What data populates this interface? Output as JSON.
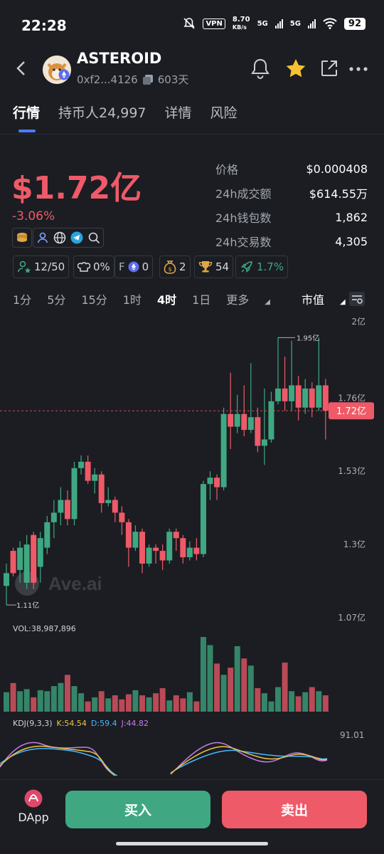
{
  "status_bar": {
    "time": "22:28",
    "vpn": "VPN",
    "speed": "8.70",
    "speed_unit": "KB/s",
    "net1": "5G",
    "net2": "5G",
    "battery": "92"
  },
  "header": {
    "title": "ASTEROID",
    "address": "0xf2...4126",
    "age": "603天"
  },
  "tabs": [
    "行情",
    "持币人24,997",
    "详情",
    "风险"
  ],
  "market": {
    "cap": "$1.72亿",
    "change": "-3.06%"
  },
  "stats": [
    {
      "label": "价格",
      "value": "$0.000408"
    },
    {
      "label": "24h成交额",
      "value": "$614.55万"
    },
    {
      "label": "24h钱包数",
      "value": "1,862"
    },
    {
      "label": "24h交易数",
      "value": "4,305"
    }
  ],
  "chips": {
    "holders": "12/50",
    "cook": "0%",
    "f": "F",
    "f_val": "0",
    "money": "2",
    "trophy": "54",
    "rocket": "1.7%"
  },
  "timeframes": {
    "items": [
      "1分",
      "5分",
      "15分",
      "1时",
      "4时",
      "1日"
    ],
    "active": "4时",
    "more": "更多",
    "metric": "市值"
  },
  "colors": {
    "up": "#3fa882",
    "down": "#ef5a68",
    "accent": "#4a7dff",
    "buy": "#3fa882",
    "sell": "#ef5a68"
  },
  "chart_data": {
    "type": "candlestick",
    "y_ticks": [
      "2亿",
      "1.76亿",
      "1.53亿",
      "1.3亿",
      "1.07亿"
    ],
    "current_label": "1.72亿",
    "high_label": "1.95亿",
    "low_label": "1.11亿",
    "watermark": "Ave.ai",
    "candles": [
      [
        1.17,
        1.21,
        1.24,
        1.11
      ],
      [
        1.28,
        1.21,
        1.29,
        1.2
      ],
      [
        1.22,
        1.29,
        1.31,
        1.18
      ],
      [
        1.18,
        1.3,
        1.33,
        1.16
      ],
      [
        1.33,
        1.18,
        1.34,
        1.16
      ],
      [
        1.23,
        1.32,
        1.34,
        1.18
      ],
      [
        1.29,
        1.37,
        1.39,
        1.27
      ],
      [
        1.37,
        1.4,
        1.44,
        1.32
      ],
      [
        1.4,
        1.44,
        1.48,
        1.36
      ],
      [
        1.44,
        1.38,
        1.47,
        1.36
      ],
      [
        1.38,
        1.54,
        1.56,
        1.36
      ],
      [
        1.54,
        1.56,
        1.58,
        1.52
      ],
      [
        1.56,
        1.5,
        1.58,
        1.49
      ],
      [
        1.5,
        1.52,
        1.54,
        1.46
      ],
      [
        1.52,
        1.43,
        1.53,
        1.4
      ],
      [
        1.43,
        1.44,
        1.48,
        1.42
      ],
      [
        1.44,
        1.4,
        1.45,
        1.37
      ],
      [
        1.4,
        1.37,
        1.42,
        1.33
      ],
      [
        1.37,
        1.29,
        1.38,
        1.23
      ],
      [
        1.29,
        1.34,
        1.36,
        1.28
      ],
      [
        1.34,
        1.24,
        1.35,
        1.21
      ],
      [
        1.24,
        1.29,
        1.3,
        1.23
      ],
      [
        1.29,
        1.28,
        1.3,
        1.24
      ],
      [
        1.28,
        1.25,
        1.3,
        1.22
      ],
      [
        1.25,
        1.34,
        1.35,
        1.24
      ],
      [
        1.34,
        1.32,
        1.35,
        1.28
      ],
      [
        1.32,
        1.26,
        1.33,
        1.24
      ],
      [
        1.26,
        1.29,
        1.31,
        1.25
      ],
      [
        1.29,
        1.27,
        1.32,
        1.25
      ],
      [
        1.27,
        1.49,
        1.5,
        1.26
      ],
      [
        1.49,
        1.51,
        1.53,
        1.44
      ],
      [
        1.51,
        1.48,
        1.52,
        1.44
      ],
      [
        1.48,
        1.71,
        1.73,
        1.47
      ],
      [
        1.71,
        1.67,
        1.84,
        1.6
      ],
      [
        1.67,
        1.71,
        1.77,
        1.65
      ],
      [
        1.71,
        1.66,
        1.8,
        1.64
      ],
      [
        1.66,
        1.7,
        1.87,
        1.65
      ],
      [
        1.7,
        1.61,
        1.73,
        1.59
      ],
      [
        1.61,
        1.63,
        1.79,
        1.55
      ],
      [
        1.63,
        1.75,
        1.78,
        1.62
      ],
      [
        1.75,
        1.79,
        1.95,
        1.74
      ],
      [
        1.79,
        1.75,
        1.89,
        1.72
      ],
      [
        1.75,
        1.8,
        1.94,
        1.72
      ],
      [
        1.8,
        1.73,
        1.83,
        1.69
      ],
      [
        1.73,
        1.79,
        1.82,
        1.71
      ],
      [
        1.79,
        1.73,
        1.81,
        1.7
      ],
      [
        1.73,
        1.8,
        1.95,
        1.72
      ],
      [
        1.8,
        1.72,
        1.82,
        1.63
      ]
    ],
    "volume_label": "VOL:38,987,896",
    "volumes": [
      1.9,
      2.8,
      2.0,
      2.2,
      1.4,
      2.1,
      2.0,
      2.5,
      2.8,
      3.6,
      2.5,
      1.8,
      1.0,
      1.4,
      2.0,
      1.3,
      1.6,
      1.2,
      1.7,
      2.1,
      1.6,
      1.4,
      1.8,
      2.3,
      1.1,
      1.6,
      1.3,
      1.9,
      1.0,
      7.3,
      6.5,
      4.7,
      3.6,
      4.3,
      6.4,
      5.2,
      4.5,
      2.3,
      1.8,
      1.0,
      2.4,
      4.8,
      2.0,
      1.5,
      1.9,
      2.4,
      2.0,
      1.6
    ],
    "kdj": {
      "label": "KDJ(9,3,3)",
      "k": "K:54.54",
      "d": "D:59.4",
      "j": "J:44.82",
      "axis": "91.01"
    }
  },
  "bottom": {
    "dapp": "DApp",
    "buy": "买入",
    "sell": "卖出"
  }
}
